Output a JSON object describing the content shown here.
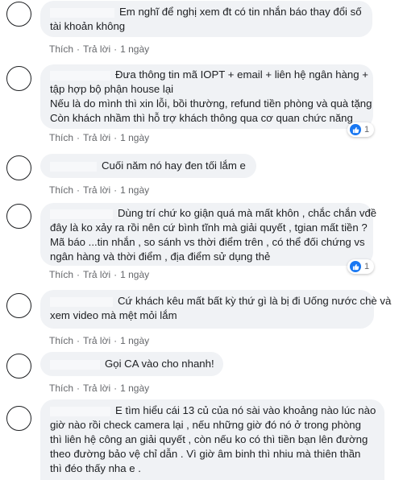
{
  "actions": {
    "like": "Thích",
    "reply": "Trả lời",
    "separator": "·"
  },
  "comments": [
    {
      "lines": [
        "Em nghĩ để nghị xem đt có tin nhắn báo thay đổi số",
        "tài khoản không"
      ],
      "time": "1 ngày"
    },
    {
      "lines": [
        "Đưa thông tin mã IOPT + email + liên hệ ngân hàng +",
        "tập hợp bộ phận house lại",
        "Nếu là do mình thì xin lỗi, bồi thường, refund tiền phòng và quà tặng",
        "Còn khách nhầm thì hỗ trợ khách thông qua cơ quan chức năng"
      ],
      "time": "1 ngày",
      "reactions": "1"
    },
    {
      "lines": [
        "Cuối năm nó hay đen tối lắm e"
      ],
      "time": "1 ngày"
    },
    {
      "lines": [
        "Dùng trí chứ ko giận quá mà mất khôn , chắc chắn vđề",
        "đây là ko xảy ra rồi nên cứ bình tĩnh mà giải quyết , tgian mất tiền ?",
        "Mã báo ...tin nhắn , so sánh vs thời điểm trên , có thể đối chứng vs",
        "ngân hàng và thời điểm , địa điểm sử dụng thẻ"
      ],
      "time": "1 ngày",
      "reactions": "1"
    },
    {
      "lines": [
        "Cứ khách kêu mất bất kỳ thứ gì là bị đi Uống nước chè và",
        "xem video mà mệt mỏi lắm"
      ],
      "time": "1 ngày"
    },
    {
      "lines": [
        "Gọi CA vào cho nhanh!"
      ],
      "time": "1 ngày"
    },
    {
      "lines": [
        "E tìm hiểu cái 13 củ của nó sài vào khoảng nào lúc nào",
        "giờ nào rồi check camera lại , nếu những giờ đó nó ở trong phòng",
        "thì liên hệ công an giải quyết , còn nếu ko có thì tiền bạn lên đường",
        "theo đường bảo vệ chỉ dẫn . Vì giờ âm binh thì nhiu mà thiên thần",
        "thì đéo thấy nha e ."
      ]
    }
  ],
  "colors": {
    "bubble": "#f0f2f5",
    "action_text": "#65676b",
    "like_blue": "#1877f2"
  }
}
